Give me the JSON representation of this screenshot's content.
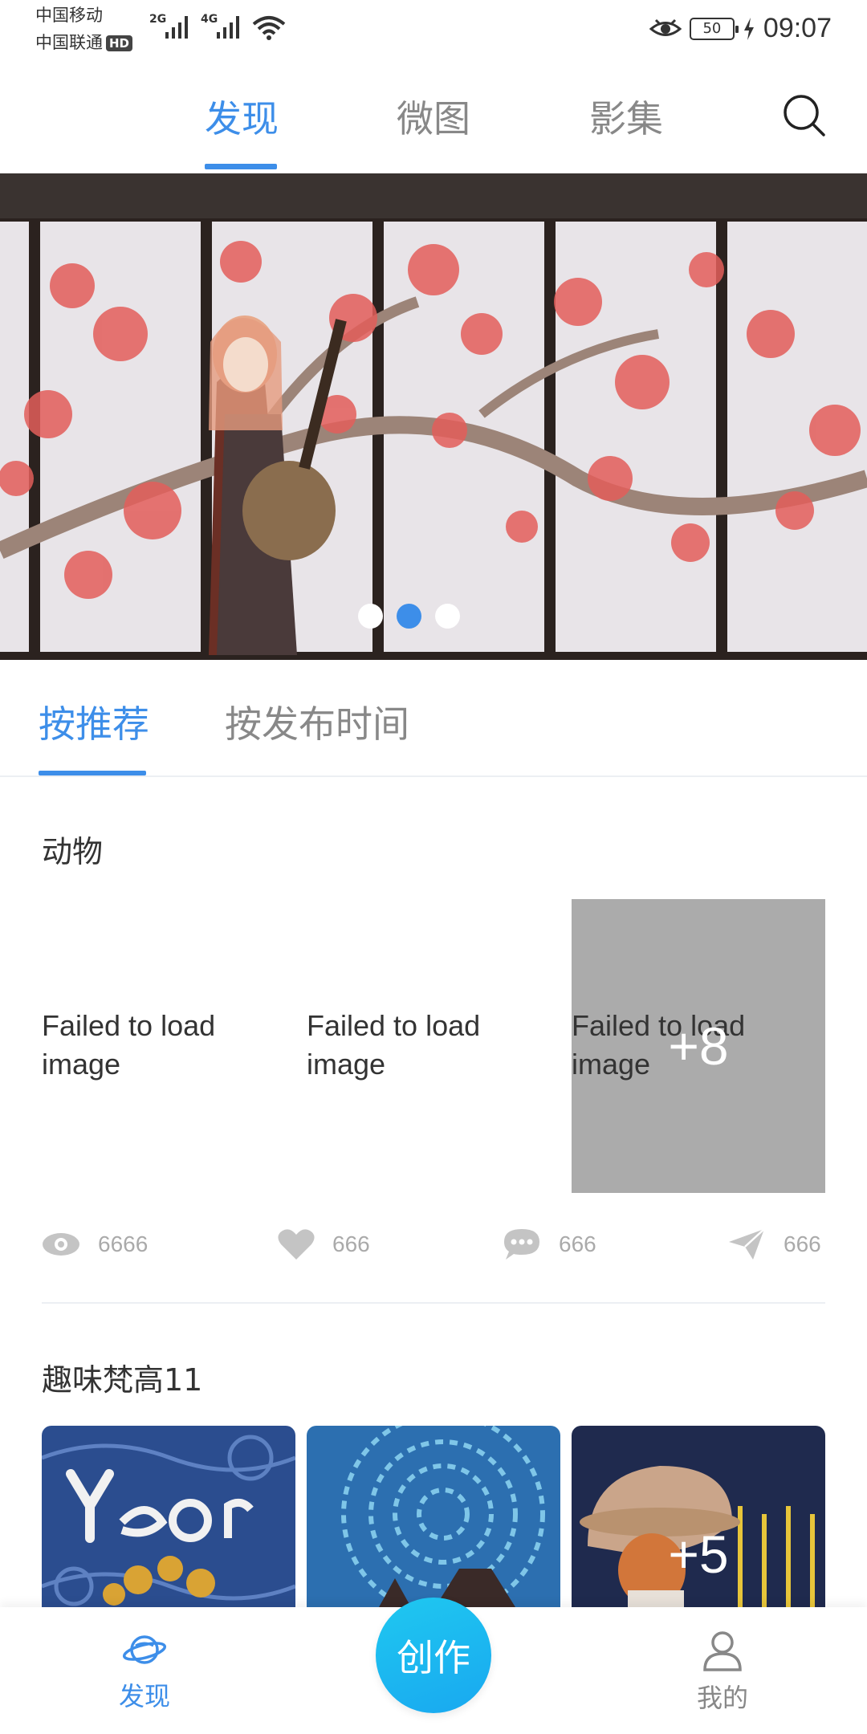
{
  "status_bar": {
    "carrier1": "中国移动",
    "carrier2": "中国联通",
    "hd_badge": "HD",
    "net1": "2G",
    "net2": "4G",
    "battery": "50",
    "time": "09:07"
  },
  "top_tabs": {
    "items": [
      {
        "label": "发现",
        "active": true
      },
      {
        "label": "微图",
        "active": false
      },
      {
        "label": "影集",
        "active": false
      }
    ],
    "search_icon": "search-icon"
  },
  "banner": {
    "dots": [
      false,
      true,
      false
    ]
  },
  "sort_tabs": {
    "items": [
      {
        "label": "按推荐",
        "active": true
      },
      {
        "label": "按发布时间",
        "active": false
      }
    ]
  },
  "card1": {
    "title": "动物",
    "failed_text": "Failed to load image",
    "more_count": "+8",
    "stats": {
      "views": "6666",
      "likes": "666",
      "comments": "666",
      "shares": "666"
    }
  },
  "card2": {
    "title": "趣味梵高11",
    "more_count": "+5"
  },
  "bottom_nav": {
    "discover": "发现",
    "create": "创作",
    "mine": "我的"
  },
  "colors": {
    "accent": "#3d8ee9",
    "create_button": "#1fc8f0"
  }
}
